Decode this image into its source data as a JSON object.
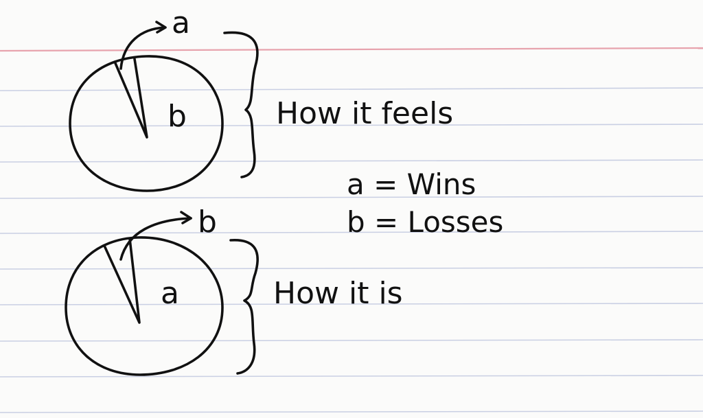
{
  "colors": {
    "paper": "#fbfbfa",
    "rule_line": "#c9cfe3",
    "margin_line": "#e7a3ad",
    "ink": "#111111"
  },
  "diagram": {
    "top": {
      "arrow_label": "a",
      "slice_label": "b",
      "caption": "How it feels"
    },
    "bottom": {
      "arrow_label": "b",
      "slice_label": "a",
      "caption": "How it is"
    },
    "legend": {
      "line_a": "a = Wins",
      "line_b": "b = Losses"
    }
  }
}
